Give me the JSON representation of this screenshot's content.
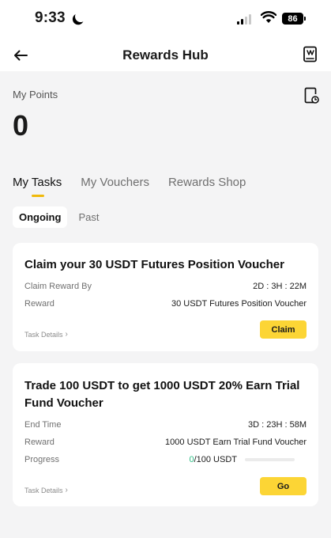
{
  "status_bar": {
    "time": "9:33",
    "battery": "86"
  },
  "header": {
    "title": "Rewards Hub"
  },
  "points": {
    "label": "My Points",
    "value": "0"
  },
  "tabs": [
    {
      "label": "My Tasks",
      "active": true
    },
    {
      "label": "My Vouchers",
      "active": false
    },
    {
      "label": "Rewards Shop",
      "active": false
    }
  ],
  "subtabs": [
    {
      "label": "Ongoing",
      "active": true
    },
    {
      "label": "Past",
      "active": false
    }
  ],
  "tasks": [
    {
      "title": "Claim your 30 USDT Futures Position Voucher",
      "rows": [
        {
          "key": "Claim Reward By",
          "value": "2D : 3H : 22M"
        },
        {
          "key": "Reward",
          "value": "30 USDT Futures Position Voucher"
        }
      ],
      "details_label": "Task Details",
      "button_label": "Claim"
    },
    {
      "title": "Trade 100 USDT to get 1000 USDT 20% Earn Trial Fund Voucher",
      "rows": [
        {
          "key": "End Time",
          "value": "3D : 23H : 58M"
        },
        {
          "key": "Reward",
          "value": "1000 USDT Earn Trial Fund Voucher"
        }
      ],
      "progress": {
        "label": "Progress",
        "current": "0",
        "target": "/100 USDT",
        "fraction": 0
      },
      "details_label": "Task Details",
      "button_label": "Go"
    }
  ],
  "colors": {
    "accent": "#fcd535",
    "tab_indicator": "#f0b90b",
    "progress_current": "#2ebd85"
  }
}
